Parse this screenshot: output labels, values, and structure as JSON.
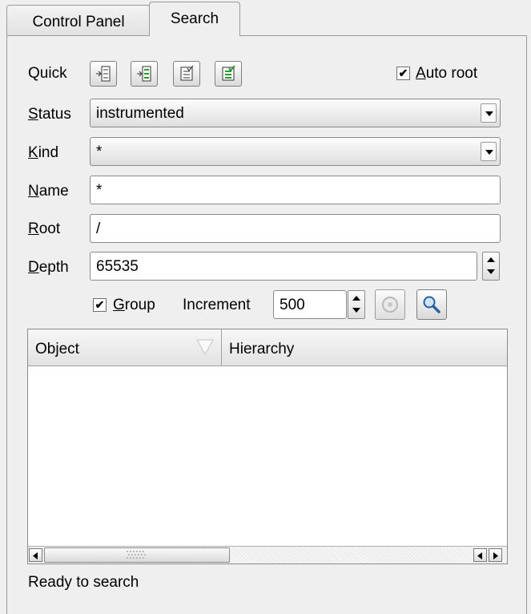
{
  "tabs": [
    {
      "label": "Control Panel",
      "active": false
    },
    {
      "label": "Search",
      "active": true
    }
  ],
  "quick": {
    "label": "Quick",
    "buttons": [
      "expand-tree-icon",
      "expand-tree-green-icon",
      "checklist-icon",
      "checklist-green-icon"
    ]
  },
  "auto_root": {
    "first": "A",
    "rest": "uto root",
    "checked": true
  },
  "status": {
    "label_first": "S",
    "label_rest": "tatus",
    "value": "instrumented"
  },
  "kind": {
    "label_first": "K",
    "label_rest": "ind",
    "value": "*"
  },
  "name": {
    "label_first": "N",
    "label_rest": "ame",
    "value": "*"
  },
  "root": {
    "label_first": "R",
    "label_rest": "oot",
    "value": "/"
  },
  "depth": {
    "label_first": "D",
    "label_rest": "epth",
    "value": "65535"
  },
  "group": {
    "first": "G",
    "rest": "roup",
    "checked": true
  },
  "increment": {
    "label": "Increment",
    "value": "500"
  },
  "table": {
    "columns": [
      "Object",
      "Hierarchy"
    ],
    "rows": []
  },
  "status_bar": "Ready to search",
  "colors": {
    "background": "#efefef",
    "border": "#9a9a9a",
    "field": "#ffffff"
  }
}
